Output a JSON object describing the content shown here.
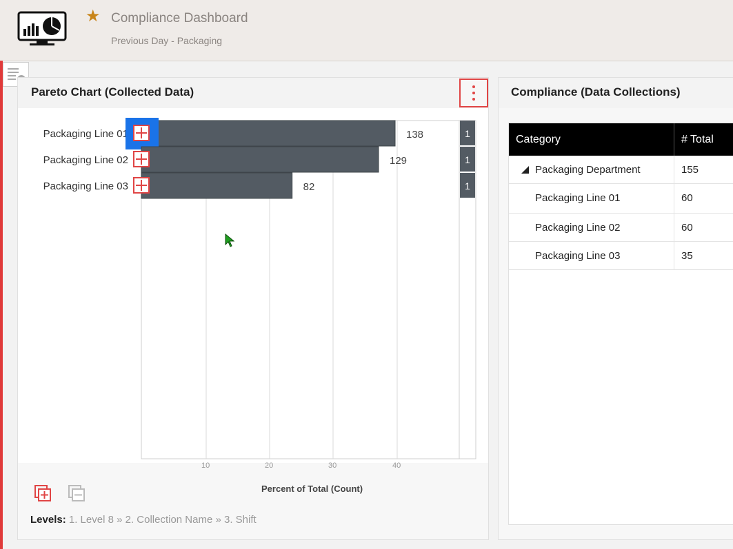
{
  "header": {
    "title": "Compliance Dashboard",
    "subtitle": "Previous Day - Packaging"
  },
  "pareto": {
    "title": "Pareto Chart (Collected Data)",
    "x_axis_title": "Percent of Total (Count)",
    "levels_label": "Levels:",
    "levels": "1. Level 8  »  2. Collection Name  »  3. Shift"
  },
  "chart_data": {
    "type": "bar",
    "orientation": "horizontal",
    "categories": [
      "Packaging Line 01",
      "Packaging Line 02",
      "Packaging Line 03"
    ],
    "values": [
      138,
      129,
      82
    ],
    "cumulative_labels": [
      "1",
      "1",
      "1"
    ],
    "x_ticks": [
      "10",
      "20",
      "30",
      "40"
    ],
    "xlabel": "Percent of Total (Count)",
    "grid": true,
    "bar_color": "#535b63"
  },
  "compliance": {
    "title": "Compliance (Data Collections)",
    "columns": [
      "Category",
      "# Total"
    ],
    "rows": [
      {
        "category": "Packaging Department",
        "total": "155"
      },
      {
        "category": "Packaging Line 01",
        "total": "60"
      },
      {
        "category": "Packaging Line 02",
        "total": "60"
      },
      {
        "category": "Packaging Line 03",
        "total": "35"
      }
    ]
  },
  "colors": {
    "accent_red": "#e04545",
    "selection_blue": "#1a73e8",
    "star": "#c9851a"
  },
  "icons": [
    "dashboard-icon",
    "star-icon",
    "collapse-panel-icon",
    "more-vert-icon",
    "expand-icon",
    "expand-all-icon",
    "collapse-all-icon",
    "cursor-icon"
  ]
}
